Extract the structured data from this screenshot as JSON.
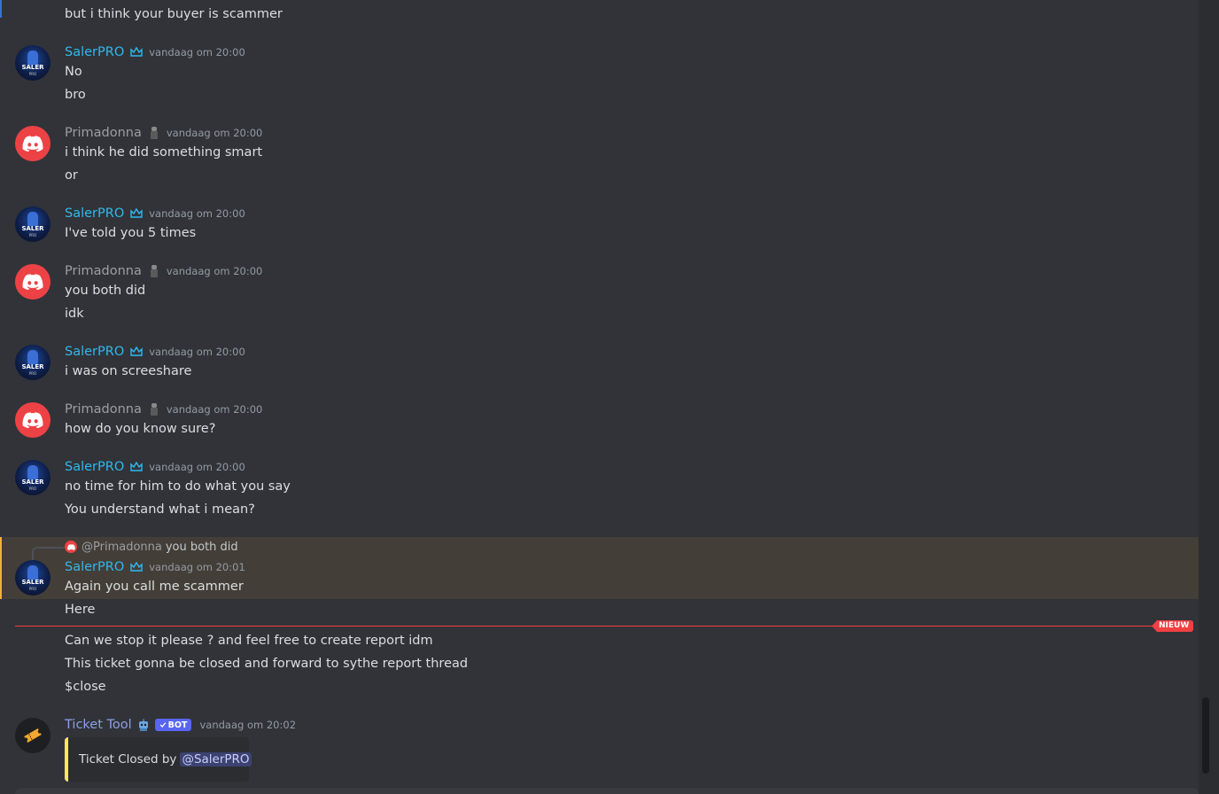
{
  "messages": {
    "top_line": "but i think your buyer is scammer",
    "m1": {
      "author": "SalerPRO",
      "time": "vandaag om 20:00",
      "lines": [
        "No",
        "bro"
      ]
    },
    "m2": {
      "author": "Primadonna",
      "time": "vandaag om 20:00",
      "lines": [
        "i think he did something smart",
        "or"
      ]
    },
    "m3": {
      "author": "SalerPRO",
      "time": "vandaag om 20:00",
      "lines": [
        "I've told you 5 times"
      ]
    },
    "m4": {
      "author": "Primadonna",
      "time": "vandaag om 20:00",
      "lines": [
        "you both did",
        "idk"
      ]
    },
    "m5": {
      "author": "SalerPRO",
      "time": "vandaag om 20:00",
      "lines": [
        "i was on screeshare"
      ]
    },
    "m6": {
      "author": "Primadonna",
      "time": "vandaag om 20:00",
      "lines": [
        "how do you know sure?"
      ]
    },
    "m7": {
      "author": "SalerPRO",
      "time": "vandaag om 20:00",
      "lines": [
        "no time for him to do what you say",
        "You understand what i mean?"
      ]
    },
    "m8": {
      "reply_name": "@Primadonna",
      "reply_text": "you both did",
      "author": "SalerPRO",
      "time": "vandaag om 20:01",
      "lines": [
        "Again you call me scammer",
        "Here",
        "Can we stop it please ? and feel free to create report idm",
        "This ticket gonna be closed and forward to sythe report thread",
        "$close"
      ]
    },
    "m9": {
      "author": "Ticket Tool",
      "bot_label": "BOT",
      "time": "vandaag om 20:02",
      "embed_text": "Ticket Closed by",
      "mention": "@SalerPRO"
    }
  },
  "new_divider_label": "NIEUW",
  "avatar_label": "SALER",
  "avatar_sub": "PRO",
  "colors": {
    "background": "#313338",
    "saler_name": "#2fb9f0",
    "prima_name": "#9b9ea4",
    "ticket_name": "#8c9fe8",
    "new_red": "#f23f43",
    "embed_bar": "#fee75c",
    "highlight": "#433e37"
  },
  "icons": {
    "saler_badge": "crown-icon",
    "prima_badge": "figure-emoji-icon",
    "ticket_badge": "robot-emoji-icon",
    "discord": "discord-logo-icon",
    "ticket_avatar": "ticket-icon"
  }
}
